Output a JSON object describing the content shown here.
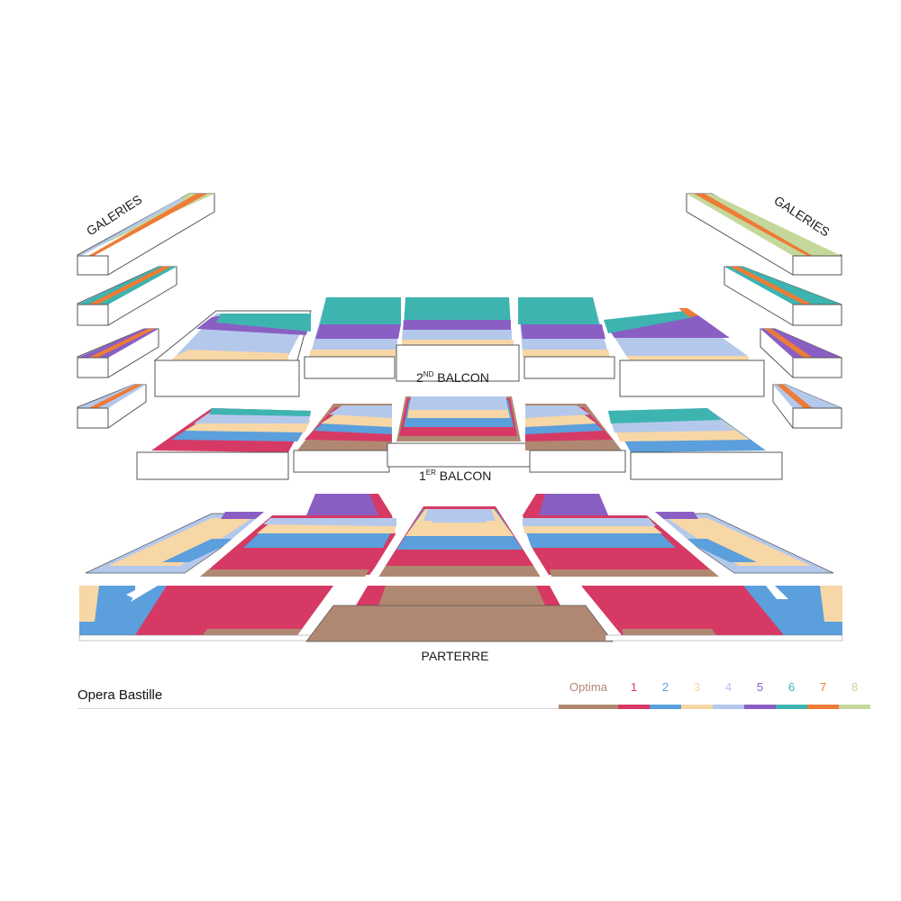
{
  "labels": {
    "galeries_left": "GALERIES",
    "galeries_right": "GALERIES",
    "balcon2_num": "2",
    "balcon2_sup": "ND",
    "balcon2_word": " BALCON",
    "balcon1_num": "1",
    "balcon1_sup": "ER",
    "balcon1_word": " BALCON",
    "parterre": "PARTERRE"
  },
  "footer": {
    "venue": "Opera Bastille"
  },
  "legend": [
    {
      "label": "Optima",
      "color": "#b08872"
    },
    {
      "label": "1",
      "color": "#d63a64"
    },
    {
      "label": "2",
      "color": "#5b9fdc"
    },
    {
      "label": "3",
      "color": "#f8d7a6"
    },
    {
      "label": "4",
      "color": "#b4c8ec"
    },
    {
      "label": "5",
      "color": "#8a5fc4"
    },
    {
      "label": "6",
      "color": "#3db4b0"
    },
    {
      "label": "7",
      "color": "#ee7b36"
    },
    {
      "label": "8",
      "color": "#c5d89c"
    }
  ]
}
